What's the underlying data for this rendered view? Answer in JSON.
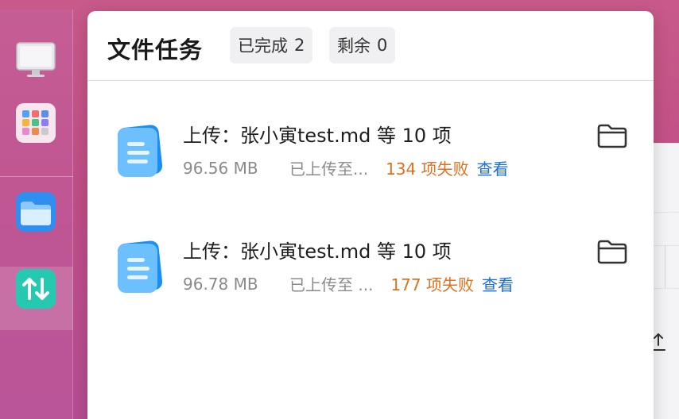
{
  "panel": {
    "title": "文件任务",
    "completed_label": "已完成",
    "completed_count": "2",
    "remaining_label": "剩余",
    "remaining_count": "0"
  },
  "tasks": [
    {
      "title": "上传：张小寅test.md 等 10 项",
      "size": "96.56 MB",
      "status": "已上传至...",
      "failed": "134 项失败",
      "view_label": "查看"
    },
    {
      "title": "上传：张小寅test.md 等 10 项",
      "size": "96.78 MB",
      "status": "已上传至 ...",
      "failed": "177 项失败",
      "view_label": "查看"
    }
  ],
  "colors": {
    "failed": "#e0701e",
    "link": "#1a6fe0"
  },
  "dock": {
    "icons": [
      "monitor-icon",
      "launchpad-icon",
      "files-icon",
      "transfer-icon"
    ],
    "active": "transfer-icon"
  }
}
